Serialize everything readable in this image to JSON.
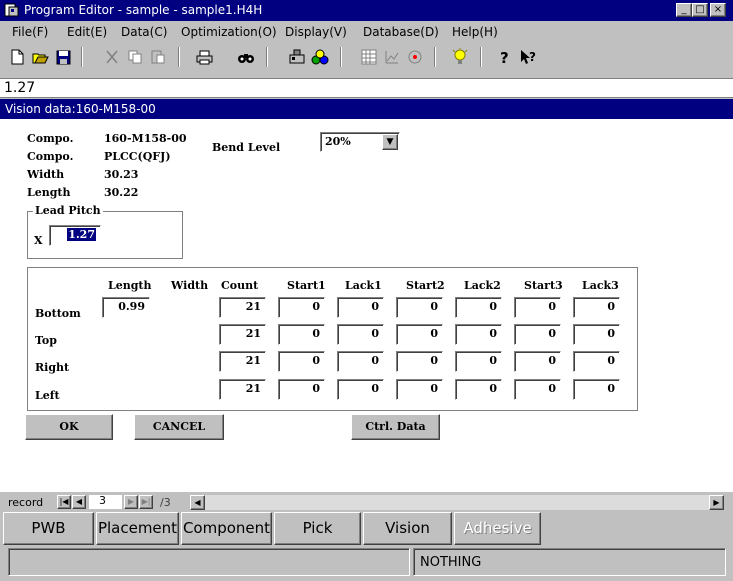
{
  "window": {
    "title": "Program Editor - sample - sample1.H4H",
    "min": "_",
    "max": "□",
    "close": "×"
  },
  "menu": [
    "File(F)",
    "Edit(E)",
    "Data(C)",
    "Optimization(O)",
    "Display(V)",
    "Database(D)",
    "Help(H)"
  ],
  "toolbar": {
    "buttons": [
      "new-file",
      "open-folder",
      "save",
      "cut",
      "copy",
      "paste",
      "print",
      "binoculars",
      "placement",
      "component",
      "grid-view",
      "chart",
      "disc",
      "light-bulb",
      "help",
      "context-help"
    ]
  },
  "value_bar": "1.27",
  "panel": {
    "title": "Vision data:160-M158-00",
    "labels": {
      "compo1": "Compo.",
      "compo2": "Compo.",
      "width": "Width",
      "length": "Length"
    },
    "values": {
      "compo1": "160-M158-00",
      "compo2": "PLCC(QFJ)",
      "width": "30.23",
      "length": "30.22"
    },
    "bend_level": {
      "label": "Bend Level",
      "value": "20%",
      "arrow": "▼"
    },
    "lead_pitch": {
      "legend": "Lead Pitch",
      "axis": "X",
      "value": "1.27"
    },
    "grid": {
      "headers": [
        "Length",
        "Width",
        "Count",
        "Start1",
        "Lack1",
        "Start2",
        "Lack2",
        "Start3",
        "Lack3"
      ],
      "rows": [
        {
          "label": "Bottom",
          "length": "0.99",
          "count": "21",
          "cells": [
            "0",
            "0",
            "0",
            "0",
            "0",
            "0"
          ]
        },
        {
          "label": "Top",
          "count": "21",
          "cells": [
            "0",
            "0",
            "0",
            "0",
            "0",
            "0"
          ]
        },
        {
          "label": "Right",
          "count": "21",
          "cells": [
            "0",
            "0",
            "0",
            "0",
            "0",
            "0"
          ]
        },
        {
          "label": "Left",
          "count": "21",
          "cells": [
            "0",
            "0",
            "0",
            "0",
            "0",
            "0"
          ]
        }
      ]
    },
    "buttons": {
      "ok": "OK",
      "cancel": "CANCEL",
      "ctrl_data": "Ctrl. Data"
    }
  },
  "record": {
    "label": "record",
    "current": "3",
    "total": "/3",
    "nav": [
      "|◀",
      "◀",
      "▶",
      "▶|"
    ]
  },
  "tabs": [
    {
      "label": "PWB",
      "enabled": true
    },
    {
      "label": "Placement",
      "enabled": true
    },
    {
      "label": "Component",
      "enabled": true
    },
    {
      "label": "Pick",
      "enabled": true
    },
    {
      "label": "Vision",
      "enabled": true
    },
    {
      "label": "Adhesive",
      "enabled": false
    }
  ],
  "status": {
    "message": "NOTHING"
  }
}
